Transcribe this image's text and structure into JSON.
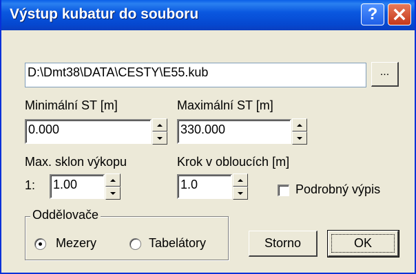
{
  "window": {
    "title": "Výstup kubatur do souboru",
    "help_label": "?",
    "close_icon": "close-icon"
  },
  "file": {
    "path": "D:\\Dmt38\\DATA\\CESTY\\E55.kub",
    "browse_label": "..."
  },
  "min_st": {
    "label": "Minimální ST [m]",
    "value": "0.000"
  },
  "max_st": {
    "label": "Maximální ST [m]",
    "value": "330.000"
  },
  "max_slope": {
    "label": "Max. sklon výkopu",
    "prefix": "1:",
    "value": "1.00"
  },
  "arc_step": {
    "label": "Krok v obloucích [m]",
    "value": "1.0"
  },
  "detailed_output": {
    "label": "Podrobný výpis",
    "checked": false
  },
  "separators": {
    "title": "Oddělovače",
    "options": [
      {
        "label": "Mezery",
        "selected": true
      },
      {
        "label": "Tabelátory",
        "selected": false
      }
    ]
  },
  "buttons": {
    "cancel": "Storno",
    "ok": "OK"
  },
  "colors": {
    "titlebar": "#0a58e0",
    "dialog_bg": "#ece9d8",
    "close_button": "#c5381a"
  }
}
